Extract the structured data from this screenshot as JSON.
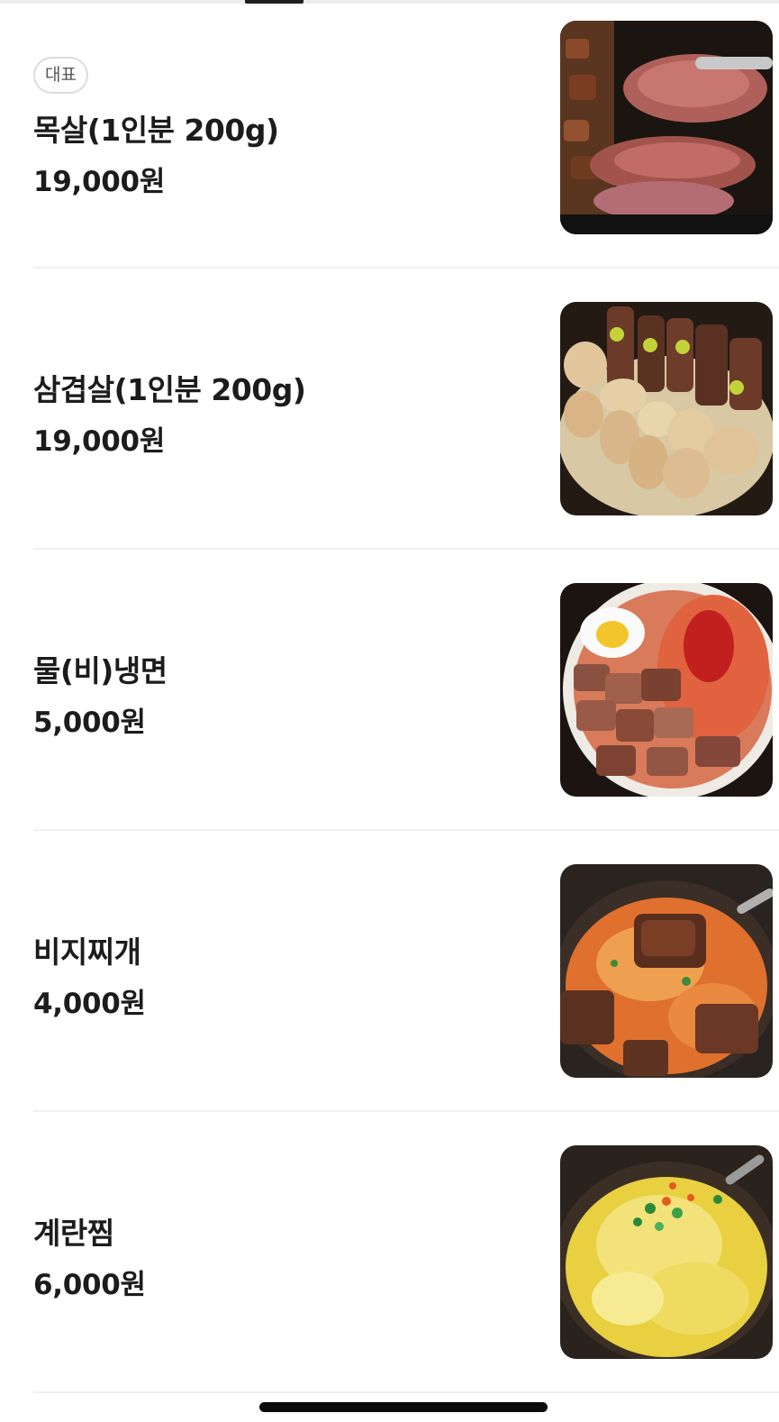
{
  "menu": {
    "items": [
      {
        "badge": "대표",
        "name": "목살(1인분 200g)",
        "price": "19,000원",
        "photo": "grilled-pork-neck-photo"
      },
      {
        "badge": "",
        "name": "삼겹살(1인분 200g)",
        "price": "19,000원",
        "photo": "grilled-pork-belly-mushroom-photo"
      },
      {
        "badge": "",
        "name": "물(비)냉면",
        "price": "5,000원",
        "photo": "cold-noodles-photo"
      },
      {
        "badge": "",
        "name": "비지찌개",
        "price": "4,000원",
        "photo": "bean-stew-photo"
      },
      {
        "badge": "",
        "name": "계란찜",
        "price": "6,000원",
        "photo": "steamed-egg-photo"
      }
    ]
  },
  "colors": {
    "text": "#1c1c1c",
    "badge_border": "#dcdcdc",
    "divider": "#f0f0f0",
    "indicator": "#1e1e1e"
  }
}
